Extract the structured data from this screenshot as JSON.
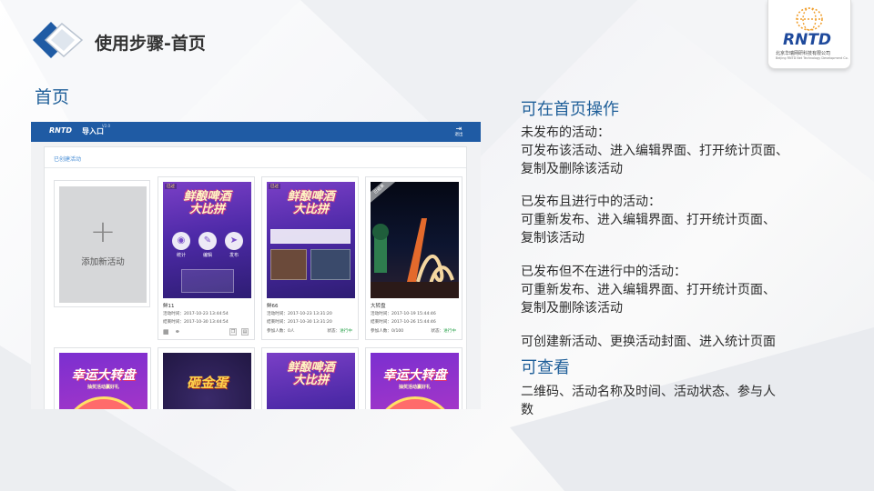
{
  "slide": {
    "title": "使用步骤-首页",
    "section": "首页"
  },
  "brand": {
    "name": "RNTD",
    "subtitle": "北京华瑞网研科技有限公司",
    "subtitle_en": "Beijing RNTD Net Technology Development Co.,Ltd"
  },
  "app": {
    "logo": "RNTD",
    "entry": "导入口",
    "entry_sup": "V2.0",
    "exit_label": "退出",
    "tab": "已创建活动",
    "add_label": "添加新活动",
    "add_glyph": "+",
    "overlay": {
      "stats": "统计",
      "edit": "编辑",
      "publish": "发布"
    },
    "cards": [
      {
        "flag": "已过",
        "cover_title": "鲜酿啤酒\n大比拼",
        "name": "鲜11",
        "start": "活动时间：2017-10-23 13:44:54",
        "end": "结束时间：2017-10-30 13:44:54"
      },
      {
        "flag": "已过",
        "cover_title": "鲜酿啤酒\n大比拼",
        "name": "鲜66",
        "start": "活动时间：2017-10-23 13:31:20",
        "end": "结束时间：2017-10-30 13:31:20",
        "participants": "参加人数：0人",
        "status_label": "状态：",
        "status_value": "进行中"
      },
      {
        "flag": "已结束",
        "name": "大转盘",
        "start": "活动时间：2017-10-19 15:44:46",
        "end": "结束时间：2017-10-26 15:44:46",
        "participants": "参加人数：0/100",
        "status_label": "状态：",
        "status_value": "进行中"
      }
    ],
    "bottom_covers": [
      {
        "title": "幸运大转盘",
        "sub": "抽奖活动赢好礼"
      },
      {
        "title": "砸金蛋",
        "sub": ""
      },
      {
        "title": "鲜酿啤酒\n大比拼",
        "sub": ""
      },
      {
        "title": "幸运大转盘",
        "sub": "抽奖活动赢好礼"
      }
    ]
  },
  "right": {
    "heading1": "可在首页操作",
    "unpublished_title": "未发布的活动：",
    "unpublished_line1": "可发布该活动、进入编辑界面、打开统计页面、",
    "unpublished_line2": "复制及删除该活动",
    "running_title": "已发布且进行中的活动：",
    "running_line1": "可重新发布、进入编辑界面、打开统计页面、",
    "running_line2": "复制该活动",
    "stopped_title": "已发布但不在进行中的活动：",
    "stopped_line1": "可重新发布、进入编辑界面、打开统计页面、",
    "stopped_line2": "复制及删除该活动",
    "create_line": "可创建新活动、更换活动封面、进入统计页面",
    "heading2": "可查看",
    "view_line1": "二维码、活动名称及时间、活动状态、参与人",
    "view_line2": "数"
  },
  "colors": {
    "accent": "#1f5f99",
    "appbar": "#1f5ba4",
    "status_green": "#2ea44f"
  }
}
